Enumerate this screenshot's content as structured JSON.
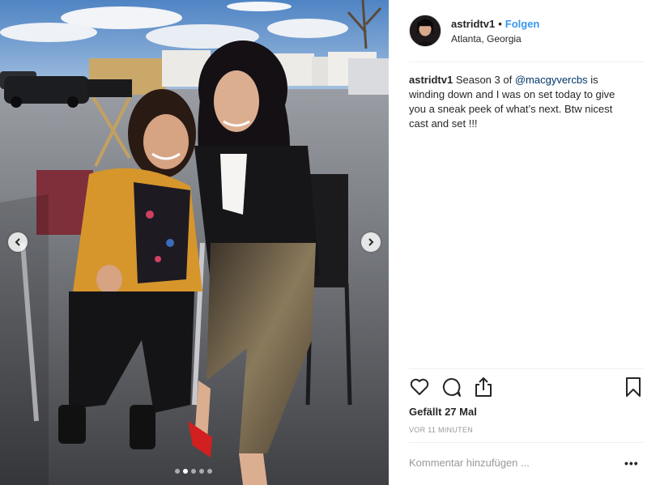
{
  "post": {
    "username": "astridtv1",
    "separator": "•",
    "follow_label": "Folgen",
    "location": "Atlanta, Georgia",
    "caption": {
      "user": "astridtv1",
      "text_before": " Season 3 of ",
      "mention": "@macgyvercbs",
      "text_after": " is winding down and I was on set today to give you a sneak peek of what’s next. Btw nicest cast and set !!!"
    },
    "likes": "Gefällt 27 Mal",
    "timestamp": "VOR 11 MINUTEN",
    "comment_placeholder": "Kommentar hinzufügen ...",
    "more_label": "•••"
  },
  "carousel": {
    "slide_count": 5,
    "active_index": 1
  },
  "icons": {
    "prev": "chevron-left-icon",
    "next": "chevron-right-icon",
    "like": "heart-icon",
    "comment": "comment-bubble-icon",
    "share": "share-upload-icon",
    "save": "bookmark-icon"
  },
  "colors": {
    "link_blue": "#3897f0",
    "mention_blue": "#003569",
    "meta_grey": "#999999",
    "text": "#262626"
  }
}
